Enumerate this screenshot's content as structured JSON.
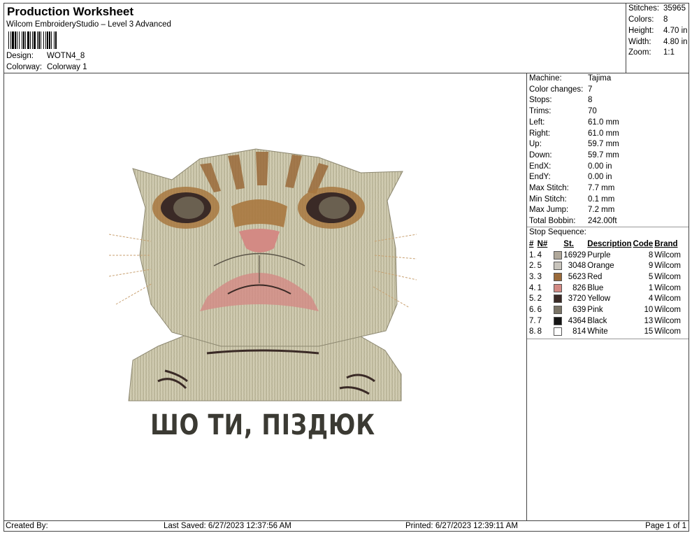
{
  "header": {
    "title": "Production Worksheet",
    "software": "Wilcom EmbroideryStudio – Level 3 Advanced",
    "design_label": "Design:",
    "design_value": "WOTN4_8",
    "colorway_label": "Colorway:",
    "colorway_value": "Colorway 1"
  },
  "summary": [
    {
      "label": "Stitches:",
      "value": "35965"
    },
    {
      "label": "Colors:",
      "value": "8"
    },
    {
      "label": "Height:",
      "value": "4.70 in"
    },
    {
      "label": "Width:",
      "value": "4.80 in"
    },
    {
      "label": "Zoom:",
      "value": "1:1"
    }
  ],
  "machine_info": [
    {
      "label": "Machine:",
      "value": "Tajima"
    },
    {
      "label": "Color changes:",
      "value": "7"
    },
    {
      "label": "Stops:",
      "value": "8"
    },
    {
      "label": "Trims:",
      "value": "70"
    },
    {
      "label": "Left:",
      "value": "61.0 mm"
    },
    {
      "label": "Right:",
      "value": "61.0 mm"
    },
    {
      "label": "Up:",
      "value": "59.7 mm"
    },
    {
      "label": "Down:",
      "value": "59.7 mm"
    },
    {
      "label": "EndX:",
      "value": "0.00 in"
    },
    {
      "label": "EndY:",
      "value": "0.00 in"
    },
    {
      "label": "Max Stitch:",
      "value": "7.7 mm"
    },
    {
      "label": "Min Stitch:",
      "value": "0.1 mm"
    },
    {
      "label": "Max Jump:",
      "value": "7.2 mm"
    },
    {
      "label": "Total Bobbin:",
      "value": "242.00ft"
    }
  ],
  "stop_sequence": {
    "title": "Stop Sequence:",
    "headers": {
      "num": "#",
      "n": "N#",
      "st": "St.",
      "desc": "Description",
      "code": "Code",
      "brand": "Brand"
    },
    "rows": [
      {
        "num": "1.",
        "n": "4",
        "color": "#b0a89a",
        "st": "16929",
        "desc": "Purple",
        "code": "8",
        "brand": "Wilcom"
      },
      {
        "num": "2.",
        "n": "5",
        "color": "#c8c4bc",
        "st": "3048",
        "desc": "Orange",
        "code": "9",
        "brand": "Wilcom"
      },
      {
        "num": "3.",
        "n": "3",
        "color": "#9a6a3a",
        "st": "5623",
        "desc": "Red",
        "code": "5",
        "brand": "Wilcom"
      },
      {
        "num": "4.",
        "n": "1",
        "color": "#d38a84",
        "st": "826",
        "desc": "Blue",
        "code": "1",
        "brand": "Wilcom"
      },
      {
        "num": "5.",
        "n": "2",
        "color": "#3a2a26",
        "st": "3720",
        "desc": "Yellow",
        "code": "4",
        "brand": "Wilcom"
      },
      {
        "num": "6.",
        "n": "6",
        "color": "#7a7466",
        "st": "639",
        "desc": "Pink",
        "code": "10",
        "brand": "Wilcom"
      },
      {
        "num": "7.",
        "n": "7",
        "color": "#151515",
        "st": "4364",
        "desc": "Black",
        "code": "13",
        "brand": "Wilcom"
      },
      {
        "num": "8.",
        "n": "8",
        "color": "#ffffff",
        "st": "814",
        "desc": "White",
        "code": "15",
        "brand": "Wilcom"
      }
    ]
  },
  "design_caption": "ШО ТИ, ПІЗДЮК",
  "footer": {
    "created": "Created By:",
    "saved": "Last Saved: 6/27/2023 12:37:56 AM",
    "printed": "Printed: 6/27/2023 12:39:11 AM",
    "page": "Page 1 of 1"
  }
}
